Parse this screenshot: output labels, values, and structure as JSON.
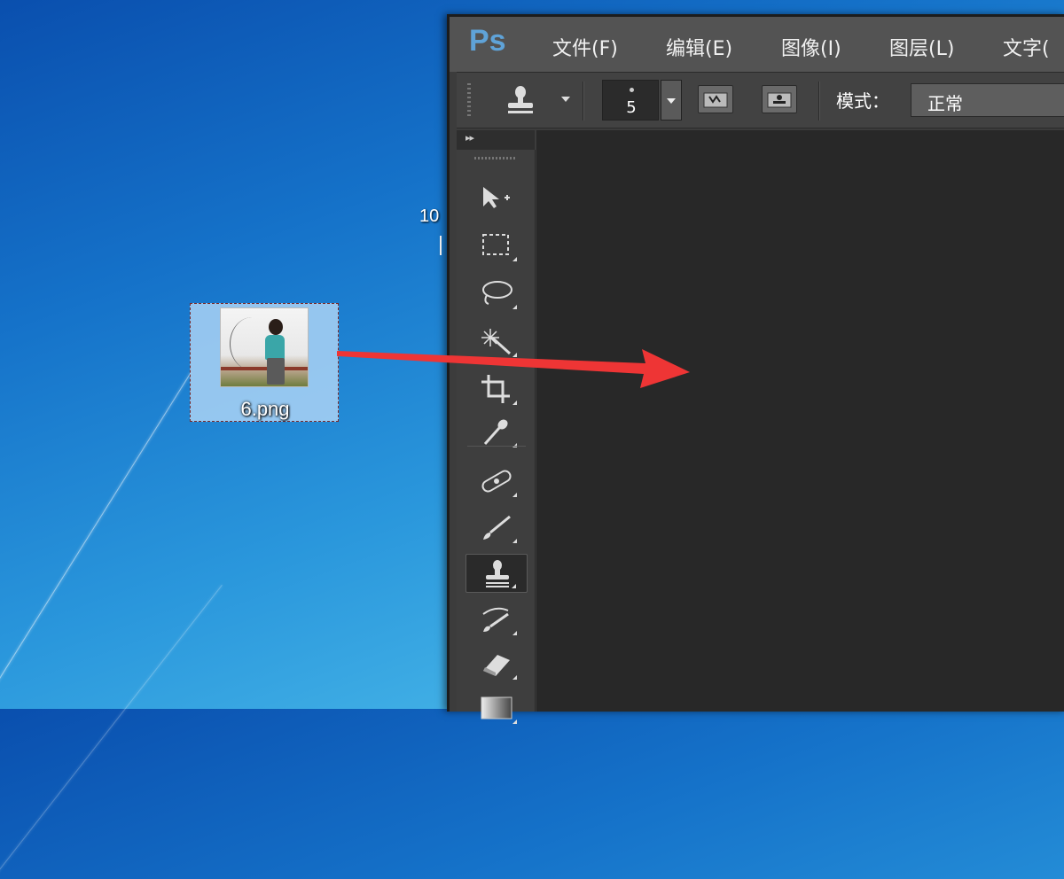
{
  "desktop": {
    "clock_fragment": "10",
    "file": {
      "name": "6.png"
    }
  },
  "photoshop": {
    "logo": "Ps",
    "menu": [
      {
        "label": "文件(F)"
      },
      {
        "label": "编辑(E)"
      },
      {
        "label": "图像(I)"
      },
      {
        "label": "图层(L)"
      },
      {
        "label": "文字("
      }
    ],
    "options": {
      "brush_size": "5",
      "mode_label": "模式：",
      "mode_value": "正常"
    },
    "tools": [
      "move-tool",
      "marquee-tool",
      "lasso-tool",
      "magic-wand-tool",
      "crop-tool",
      "eyedropper-tool",
      "healing-brush-tool",
      "brush-tool",
      "clone-stamp-tool",
      "history-brush-tool",
      "eraser-tool",
      "gradient-tool"
    ],
    "active_tool": "clone-stamp-tool"
  },
  "colors": {
    "arrow": "#ee3535",
    "ps_logo": "#5fa3d8",
    "canvas": "#282828"
  }
}
